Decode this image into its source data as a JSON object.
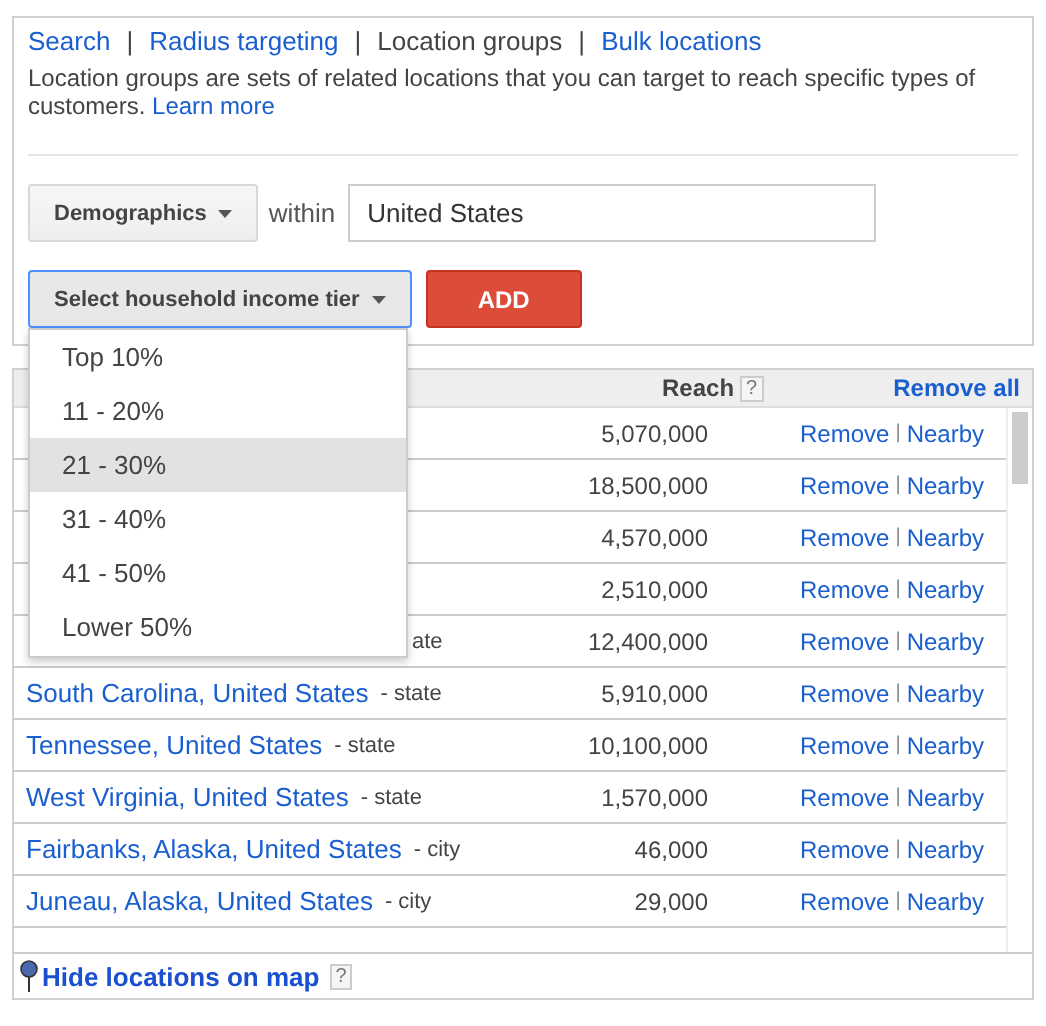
{
  "nav": [
    {
      "label": "Search",
      "selected": false
    },
    {
      "label": "Radius targeting",
      "selected": false
    },
    {
      "label": "Location groups",
      "selected": true
    },
    {
      "label": "Bulk locations",
      "selected": false
    }
  ],
  "nav_separators": [
    "|",
    "|",
    "|"
  ],
  "description": {
    "text": "Location groups are sets of related locations that you can target to reach specific types of customers.",
    "link": "Learn more"
  },
  "group_type": "Demographics",
  "within_label": "within",
  "within_field": {
    "value": "United States"
  },
  "tier_select": {
    "label": "Select household income tier",
    "expanded": true,
    "options": [
      {
        "label": "Top 10%",
        "selected": false
      },
      {
        "label": "11 - 20%",
        "selected": false
      },
      {
        "label": "21 - 30%",
        "selected": true
      },
      {
        "label": "31 - 40%",
        "selected": false
      },
      {
        "label": "41 - 50%",
        "selected": false
      },
      {
        "label": "Lower 50%",
        "selected": false
      }
    ]
  },
  "add_button": "ADD",
  "table": {
    "columns": {
      "reach": "Reach",
      "reach_help": "?",
      "remove_all": "Remove all"
    },
    "rows": [
      {
        "reach": "5,070,000",
        "remove": "Remove",
        "separator": "|",
        "nearby": "Nearby"
      },
      {
        "reach": "18,500,000",
        "remove": "Remove",
        "separator": "|",
        "nearby": "Nearby"
      },
      {
        "reach": "4,570,000",
        "remove": "Remove",
        "separator": "|",
        "nearby": "Nearby"
      },
      {
        "reach": "2,510,000",
        "remove": "Remove",
        "separator": "|",
        "nearby": "Nearby"
      },
      {
        "type": "ate",
        "reach": "12,400,000",
        "remove": "Remove",
        "separator": "|",
        "nearby": "Nearby"
      },
      {
        "name": "South Carolina, United States",
        "type": "- state",
        "reach": "5,910,000",
        "remove": "Remove",
        "separator": "|",
        "nearby": "Nearby"
      },
      {
        "name": "Tennessee, United States",
        "type": "- state",
        "reach": "10,100,000",
        "remove": "Remove",
        "separator": "|",
        "nearby": "Nearby"
      },
      {
        "name": "West Virginia, United States",
        "type": "- state",
        "reach": "1,570,000",
        "remove": "Remove",
        "separator": "|",
        "nearby": "Nearby"
      },
      {
        "name": "Fairbanks, Alaska, United States",
        "type": "- city",
        "reach": "46,000",
        "remove": "Remove",
        "separator": "|",
        "nearby": "Nearby"
      },
      {
        "name": "Juneau, Alaska, United States",
        "type": "- city",
        "reach": "29,000",
        "remove": "Remove",
        "separator": "|",
        "nearby": "Nearby"
      }
    ]
  },
  "map_toggle": {
    "label": "Hide locations on map",
    "help": "?"
  }
}
